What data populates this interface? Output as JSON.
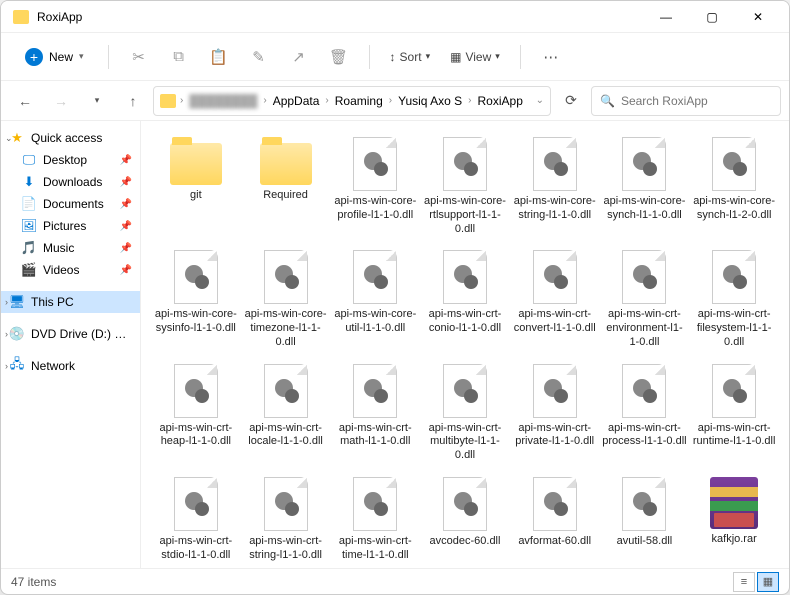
{
  "window": {
    "title": "RoxiApp"
  },
  "toolbar": {
    "new_label": "New",
    "sort_label": "Sort",
    "view_label": "View"
  },
  "breadcrumb": {
    "items": [
      "",
      "AppData",
      "Roaming",
      "Yusiq Axo S",
      "RoxiApp"
    ]
  },
  "search": {
    "placeholder": "Search RoxiApp"
  },
  "sidebar": {
    "quick_access": "Quick access",
    "items": [
      {
        "label": "Desktop",
        "icon": "🖵",
        "color": "#0078d4"
      },
      {
        "label": "Downloads",
        "icon": "⬇",
        "color": "#0078d4"
      },
      {
        "label": "Documents",
        "icon": "📄",
        "color": "#0078d4"
      },
      {
        "label": "Pictures",
        "icon": "🖼",
        "color": "#0078d4"
      },
      {
        "label": "Music",
        "icon": "🎵",
        "color": "#d83b01"
      },
      {
        "label": "Videos",
        "icon": "🎬",
        "color": "#0078d4"
      }
    ],
    "this_pc": "This PC",
    "dvd": "DVD Drive (D:) CCCC",
    "network": "Network"
  },
  "files": [
    {
      "name": "git",
      "type": "folder"
    },
    {
      "name": "Required",
      "type": "folder"
    },
    {
      "name": "api-ms-win-core-profile-l1-1-0.dll",
      "type": "dll"
    },
    {
      "name": "api-ms-win-core-rtlsupport-l1-1-0.dll",
      "type": "dll"
    },
    {
      "name": "api-ms-win-core-string-l1-1-0.dll",
      "type": "dll"
    },
    {
      "name": "api-ms-win-core-synch-l1-1-0.dll",
      "type": "dll"
    },
    {
      "name": "api-ms-win-core-synch-l1-2-0.dll",
      "type": "dll"
    },
    {
      "name": "api-ms-win-core-sysinfo-l1-1-0.dll",
      "type": "dll"
    },
    {
      "name": "api-ms-win-core-timezone-l1-1-0.dll",
      "type": "dll"
    },
    {
      "name": "api-ms-win-core-util-l1-1-0.dll",
      "type": "dll"
    },
    {
      "name": "api-ms-win-crt-conio-l1-1-0.dll",
      "type": "dll"
    },
    {
      "name": "api-ms-win-crt-convert-l1-1-0.dll",
      "type": "dll"
    },
    {
      "name": "api-ms-win-crt-environment-l1-1-0.dll",
      "type": "dll"
    },
    {
      "name": "api-ms-win-crt-filesystem-l1-1-0.dll",
      "type": "dll"
    },
    {
      "name": "api-ms-win-crt-heap-l1-1-0.dll",
      "type": "dll"
    },
    {
      "name": "api-ms-win-crt-locale-l1-1-0.dll",
      "type": "dll"
    },
    {
      "name": "api-ms-win-crt-math-l1-1-0.dll",
      "type": "dll"
    },
    {
      "name": "api-ms-win-crt-multibyte-l1-1-0.dll",
      "type": "dll"
    },
    {
      "name": "api-ms-win-crt-private-l1-1-0.dll",
      "type": "dll"
    },
    {
      "name": "api-ms-win-crt-process-l1-1-0.dll",
      "type": "dll"
    },
    {
      "name": "api-ms-win-crt-runtime-l1-1-0.dll",
      "type": "dll"
    },
    {
      "name": "api-ms-win-crt-stdio-l1-1-0.dll",
      "type": "dll"
    },
    {
      "name": "api-ms-win-crt-string-l1-1-0.dll",
      "type": "dll"
    },
    {
      "name": "api-ms-win-crt-time-l1-1-0.dll",
      "type": "dll"
    },
    {
      "name": "avcodec-60.dll",
      "type": "dll"
    },
    {
      "name": "avformat-60.dll",
      "type": "dll"
    },
    {
      "name": "avutil-58.dll",
      "type": "dll"
    },
    {
      "name": "kafkjo.rar",
      "type": "rar"
    }
  ],
  "status": {
    "count": "47 items"
  }
}
